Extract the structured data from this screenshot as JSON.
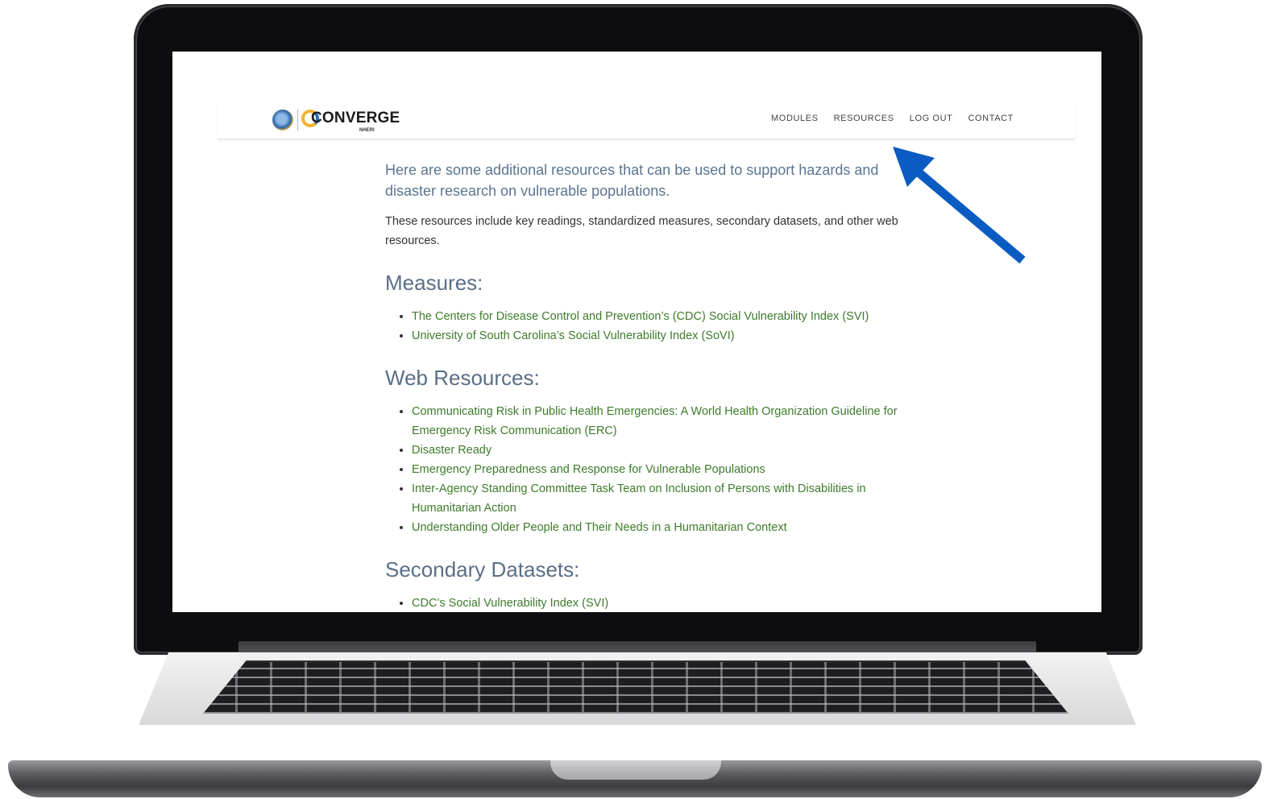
{
  "site": {
    "logo": {
      "text": "CONVERGE",
      "sub": "NHERI"
    },
    "nav": [
      "MODULES",
      "RESOURCES",
      "LOG OUT",
      "CONTACT"
    ]
  },
  "content": {
    "lead": "Here are some additional resources that can be used to support hazards and disaster research on vulnerable populations.",
    "intro": "These resources include key readings, standardized measures, secondary datasets, and other web resources.",
    "sections": [
      {
        "heading": "Measures:",
        "items": [
          "The Centers for Disease Control and Prevention’s (CDC) Social Vulnerability Index (SVI)",
          "University of South Carolina’s Social Vulnerability Index (SoVI)"
        ]
      },
      {
        "heading": "Web Resources:",
        "items": [
          "Communicating Risk in Public Health Emergencies: A World Health Organization Guideline for Emergency Risk Communication (ERC)",
          "Disaster Ready",
          "Emergency Preparedness and Response for Vulnerable Populations",
          "Inter-Agency Standing Committee Task Team on Inclusion of Persons with Disabilities in Humanitarian Action",
          "Understanding Older People and Their Needs in a Humanitarian Context"
        ]
      },
      {
        "heading": "Secondary Datasets:",
        "items": [
          "CDC’s Social Vulnerability Index (SVI)"
        ]
      }
    ]
  },
  "colors": {
    "link": "#3e7b2b",
    "heading": "#5a6f86",
    "arrow": "#0b5cc2"
  },
  "icons": [
    "nsf-logo-icon",
    "converge-logo-icon",
    "annotation-arrow-icon"
  ]
}
